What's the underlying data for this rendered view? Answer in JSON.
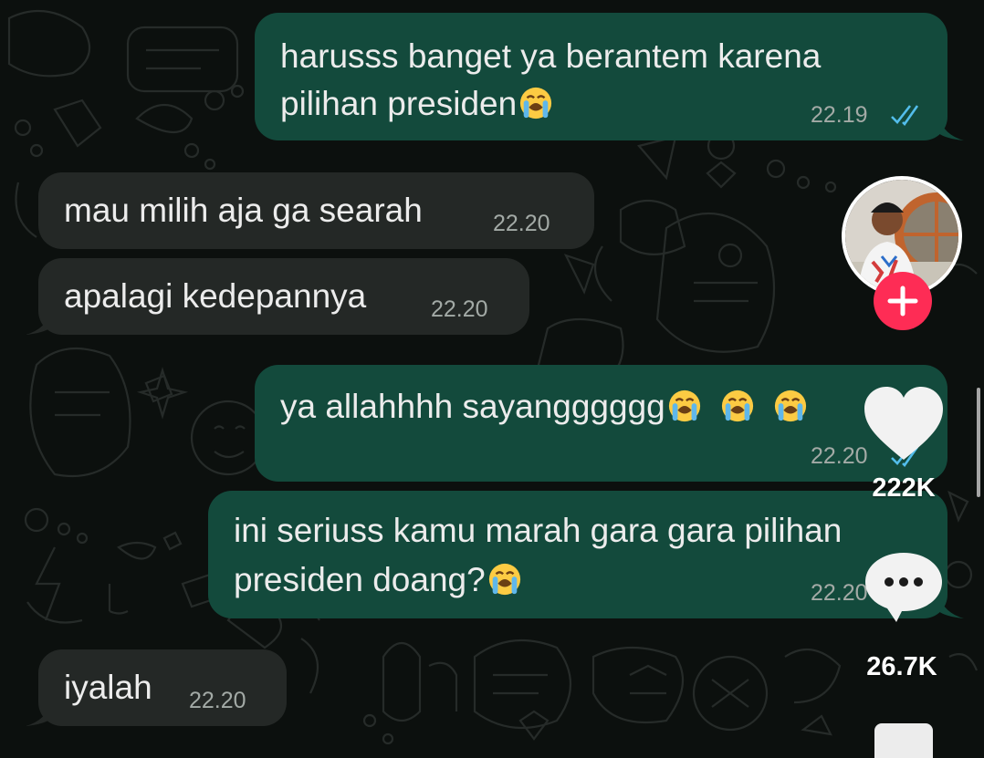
{
  "messages": [
    {
      "id": "m1",
      "direction": "outgoing",
      "lines": [
        "harusss banget ya berantem karena",
        "pilihan presiden"
      ],
      "emoji_after": [
        "loudly-crying-face"
      ],
      "time": "22.19",
      "status": "read"
    },
    {
      "id": "m2",
      "direction": "incoming",
      "lines": [
        "mau milih aja ga searah"
      ],
      "time": "22.20"
    },
    {
      "id": "m3",
      "direction": "incoming",
      "lines": [
        "apalagi kedepannya"
      ],
      "time": "22.20"
    },
    {
      "id": "m4",
      "direction": "outgoing",
      "lines": [
        "ya allahhhh sayangggggg"
      ],
      "emoji_after": [
        "loudly-crying-face",
        "loudly-crying-face",
        "loudly-crying-face"
      ],
      "time": "22.20",
      "status": "read"
    },
    {
      "id": "m5",
      "direction": "outgoing",
      "lines": [
        "ini seriuss kamu marah gara gara pilihan",
        "presiden doang?"
      ],
      "emoji_after": [
        "loudly-crying-face"
      ],
      "time": "22.20",
      "status": "read"
    },
    {
      "id": "m6",
      "direction": "incoming",
      "lines": [
        "iyalah"
      ],
      "time": "22.20"
    }
  ],
  "overlay": {
    "avatar_icon": "profile-avatar",
    "follow_icon": "plus-icon",
    "like_icon": "heart-icon",
    "like_count": "222K",
    "comment_icon": "comment-bubble-icon",
    "comment_count": "26.7K",
    "bookmark_icon": "bookmark-icon"
  },
  "colors": {
    "background": "#0c100e",
    "outgoing_bubble": "#134a3c",
    "incoming_bubble": "#242826",
    "read_ticks": "#53bdeb",
    "follow_button": "#fe2c55"
  }
}
